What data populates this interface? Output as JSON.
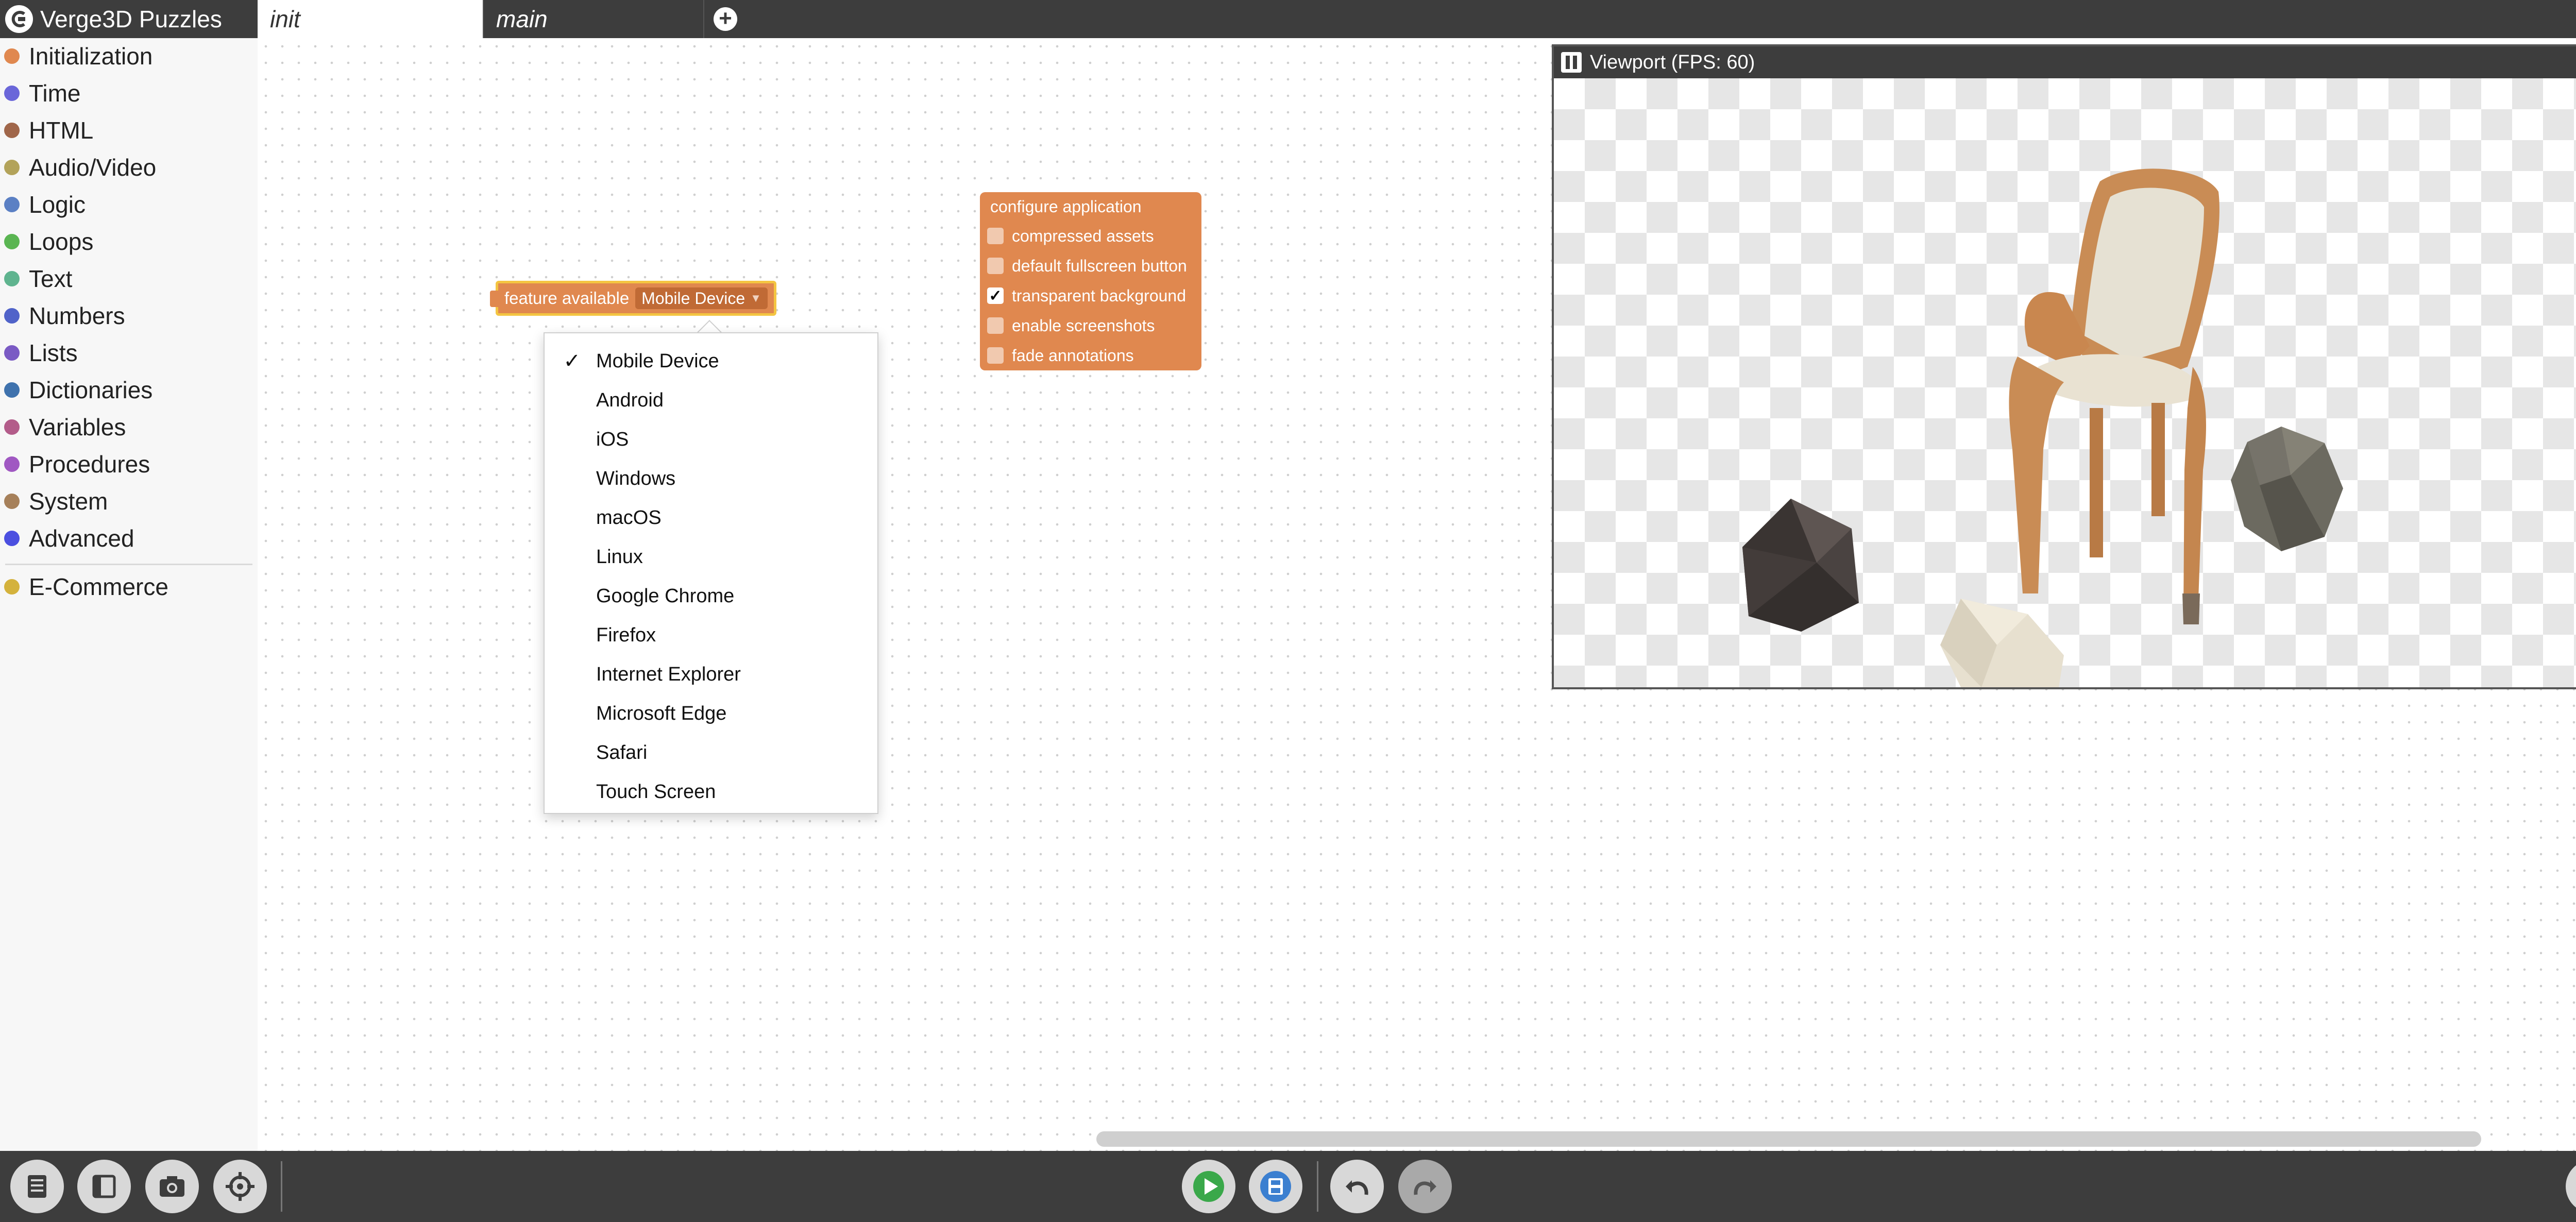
{
  "app": {
    "title": "Verge3D Puzzles"
  },
  "tabs": [
    {
      "label": "init",
      "active": true
    },
    {
      "label": "main",
      "active": false
    }
  ],
  "sidebar": {
    "categories": [
      {
        "label": "Initialization",
        "color": "#e0884f"
      },
      {
        "label": "Time",
        "color": "#6a66d9"
      },
      {
        "label": "HTML",
        "color": "#a0664a"
      },
      {
        "label": "Audio/Video",
        "color": "#b3a35a"
      },
      {
        "label": "Logic",
        "color": "#5b80c4"
      },
      {
        "label": "Loops",
        "color": "#5ab552"
      },
      {
        "label": "Text",
        "color": "#5fb48f"
      },
      {
        "label": "Numbers",
        "color": "#5063c9"
      },
      {
        "label": "Lists",
        "color": "#7a5ac4"
      },
      {
        "label": "Dictionaries",
        "color": "#3f72ad"
      },
      {
        "label": "Variables",
        "color": "#b35c8a"
      },
      {
        "label": "Procedures",
        "color": "#a058c2"
      },
      {
        "label": "System",
        "color": "#a6805a"
      },
      {
        "label": "Advanced",
        "color": "#4b4fe0"
      }
    ],
    "extra_categories": [
      {
        "label": "E-Commerce",
        "color": "#d4b23c"
      }
    ]
  },
  "feature_block": {
    "label": "feature available",
    "selected": "Mobile Device"
  },
  "dropdown": {
    "checkmark": "✓",
    "selected_index": 0,
    "options": [
      "Mobile Device",
      "Android",
      "iOS",
      "Windows",
      "macOS",
      "Linux",
      "Google Chrome",
      "Firefox",
      "Internet Explorer",
      "Microsoft Edge",
      "Safari",
      "Touch Screen"
    ]
  },
  "configure_block": {
    "title": "configure application",
    "options": [
      {
        "label": "compressed assets",
        "checked": false
      },
      {
        "label": "default fullscreen button",
        "checked": false
      },
      {
        "label": "transparent background",
        "checked": true
      },
      {
        "label": "enable screenshots",
        "checked": false
      },
      {
        "label": "fade annotations",
        "checked": false
      }
    ]
  },
  "viewport": {
    "title": "Viewport (FPS: 60)",
    "close_glyph": "✕"
  },
  "bottom_toolbar": {
    "icons": [
      "library-icon",
      "sidebar-toggle-icon",
      "camera-icon",
      "target-icon",
      "play-icon",
      "save-icon",
      "undo-icon",
      "redo-icon",
      "help-icon"
    ]
  },
  "colors": {
    "topbar": "#3d3d3d",
    "puzzle_orange": "#e0884f",
    "selection_yellow": "#f4c542",
    "play_green": "#3aa84a",
    "save_blue": "#3b7fd0"
  }
}
